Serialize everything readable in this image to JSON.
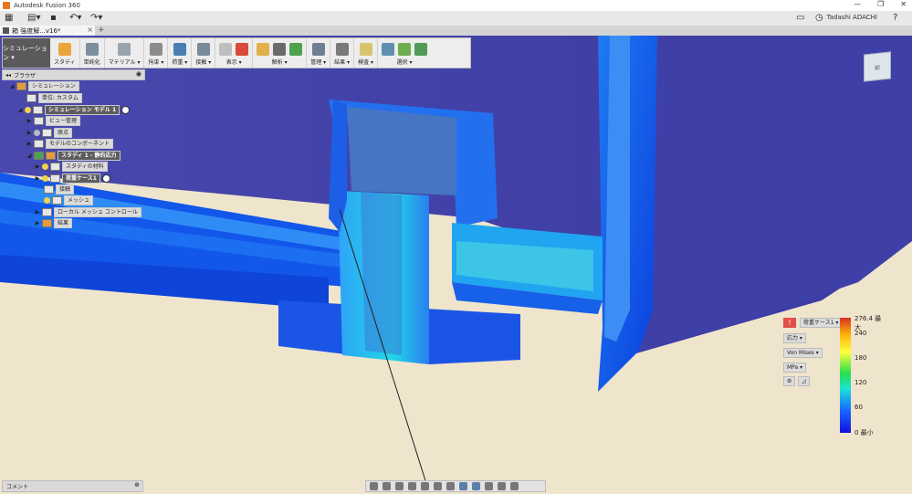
{
  "window": {
    "title": "Autodesk Fusion 360",
    "minimize": "—",
    "restore": "❐",
    "close": "✕"
  },
  "qat": {
    "user": "Tadashi ADACHI",
    "help": "?"
  },
  "doc_tab": {
    "label": "箱 強度解...v16*",
    "close": "×",
    "add": "+"
  },
  "toolbar": {
    "workspace": "シミュレーション ▾",
    "groups": [
      {
        "label": "スタディ"
      },
      {
        "label": "単純化"
      },
      {
        "label": "マテリアル ▾"
      },
      {
        "label": "拘束 ▾"
      },
      {
        "label": "荷重 ▾"
      },
      {
        "label": "接触 ▾"
      },
      {
        "label": "表示 ▾"
      },
      {
        "label": "解析 ▾"
      },
      {
        "label": "管理 ▾"
      },
      {
        "label": "結果 ▾"
      },
      {
        "label": "検査 ▾"
      },
      {
        "label": "選択 ▾"
      }
    ]
  },
  "browser": {
    "title": "ブラウザ",
    "nodes": [
      {
        "label": "シミュレーション"
      },
      {
        "label": "単位: カスタム"
      },
      {
        "label": "シミュレーション モデル 1"
      },
      {
        "label": "ビュー管理"
      },
      {
        "label": "原点"
      },
      {
        "label": "モデルのコンポーネント"
      },
      {
        "label": "スタディ 1 - 静的応力"
      },
      {
        "label": "スタディの材料"
      },
      {
        "label": "荷重ケース1"
      },
      {
        "label": "接触"
      },
      {
        "label": "メッシュ"
      },
      {
        "label": "ローカル メッシュ コントロール"
      },
      {
        "label": "結果"
      }
    ]
  },
  "viewcube": {
    "face": "前"
  },
  "legend": {
    "load_case": "荷重ケース1 ▾",
    "result_type": "応力 ▾",
    "criterion": "Von Mises ▾",
    "unit": "MPa ▾",
    "ticks": [
      "276.4 最大",
      "240",
      "180",
      "120",
      "60",
      "0 最小"
    ],
    "colors": {
      "max": "#d7301f",
      "mid": "#26e04a",
      "min": "#1010e0"
    }
  },
  "comments": {
    "label": "コメント"
  }
}
